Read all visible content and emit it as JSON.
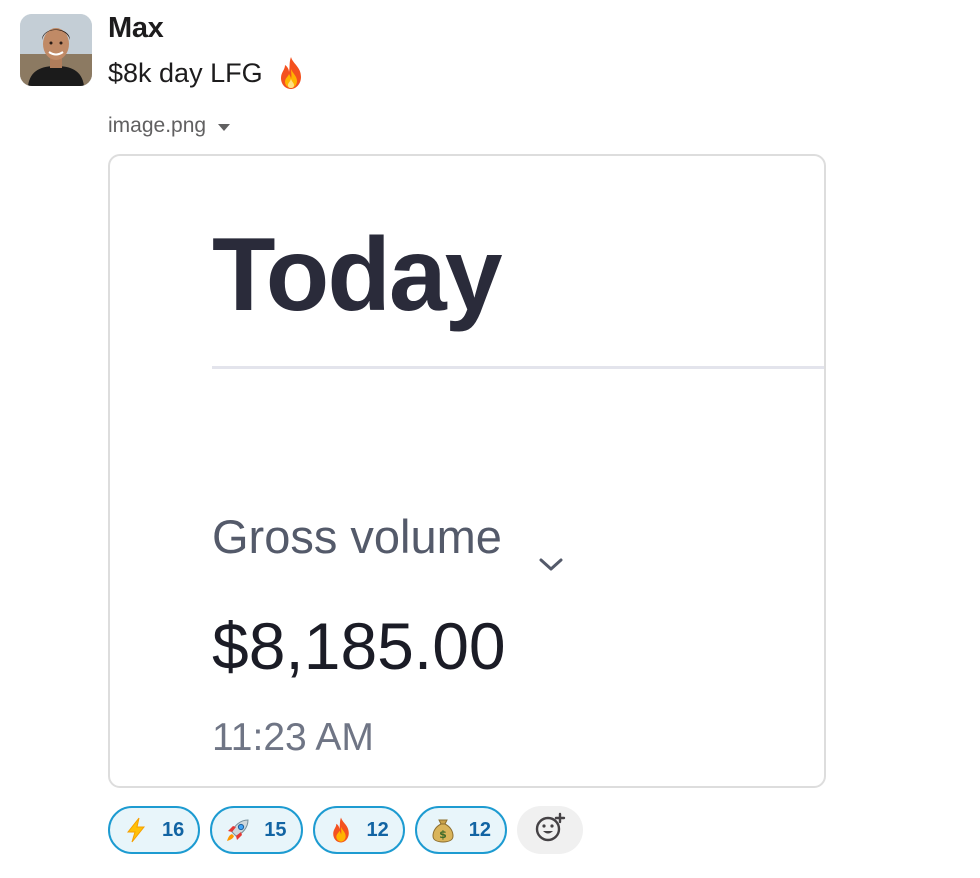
{
  "message": {
    "sender": "Max",
    "text": "$8k day LFG",
    "text_emoji_icon": "fire-icon"
  },
  "attachment": {
    "filename": "image.png",
    "toggle_icon": "caret-down-icon",
    "screenshot": {
      "title": "Today",
      "metric_label": "Gross volume",
      "metric_value": "$8,185.00",
      "time": "11:23 AM"
    }
  },
  "reactions": [
    {
      "icon": "lightning-icon",
      "count": "16"
    },
    {
      "icon": "rocket-icon",
      "count": "15"
    },
    {
      "icon": "fire-icon",
      "count": "12"
    },
    {
      "icon": "money-bag-icon",
      "count": "12"
    }
  ],
  "add_reaction": {
    "icon": "add-reaction-icon"
  },
  "colors": {
    "reaction_border": "#1d9bd1",
    "reaction_bg": "#e8f5fa",
    "reaction_count": "#1264a3"
  }
}
